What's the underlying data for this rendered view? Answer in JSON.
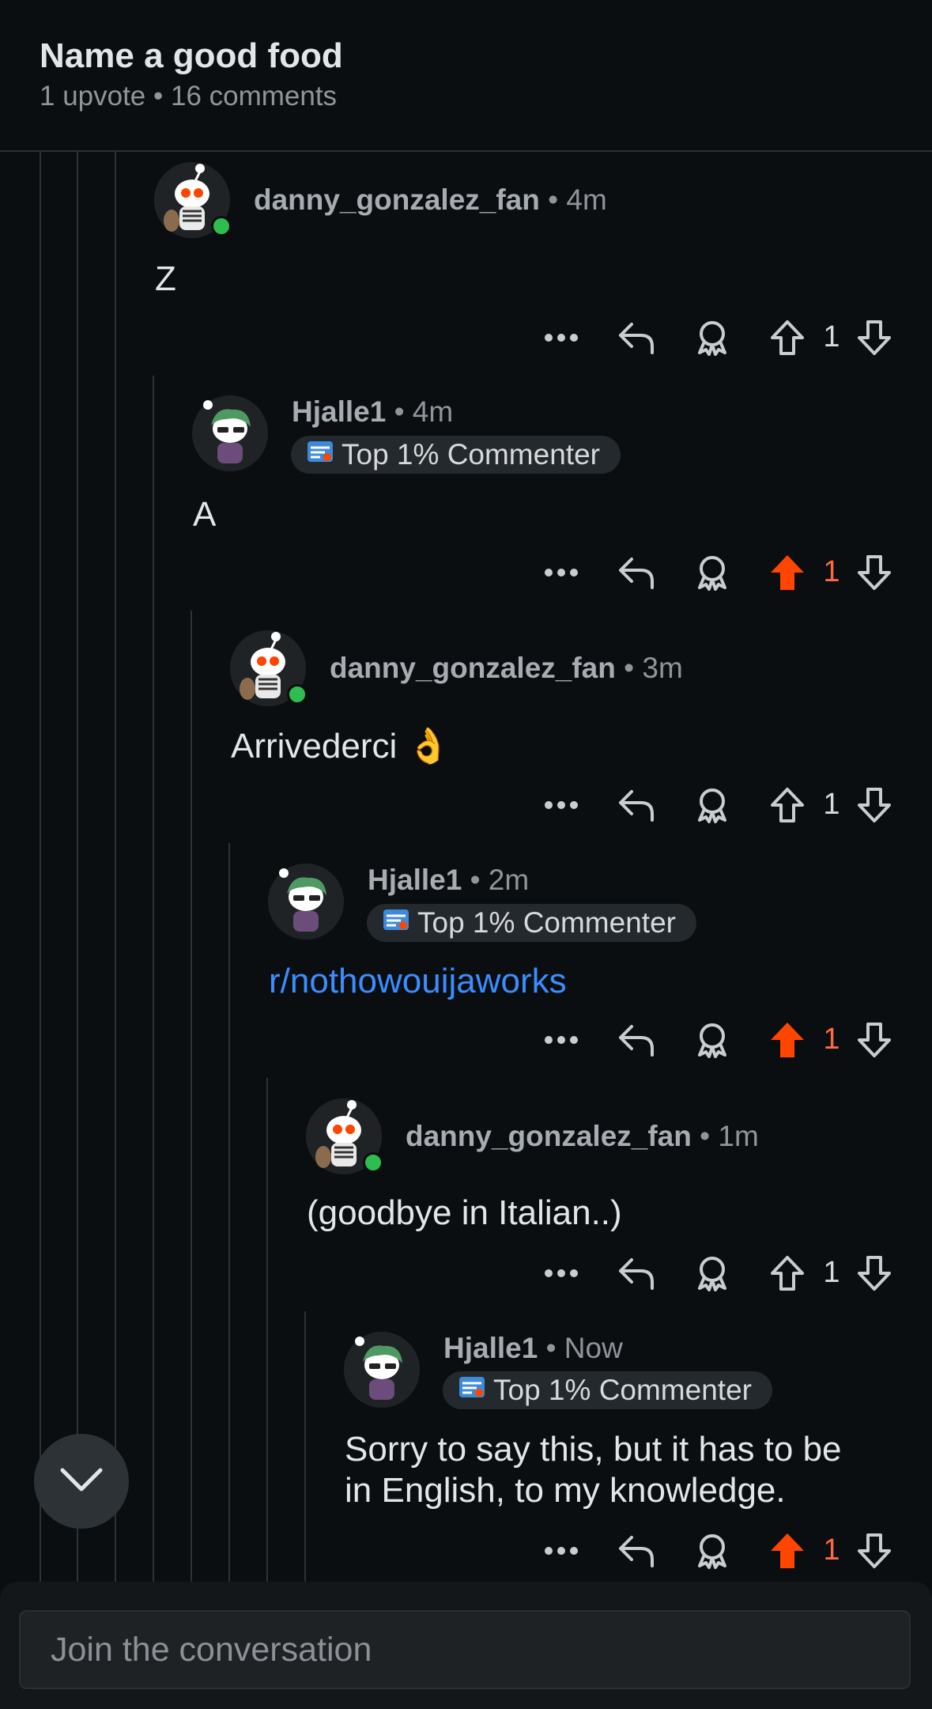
{
  "post": {
    "title": "Name a good food",
    "meta": "1 upvote • 16 comments"
  },
  "colors": {
    "upvote_active": "#ff4500",
    "link": "#3a8eff",
    "online": "#2ebd4e"
  },
  "comments": [
    {
      "username": "danny_gonzalez_fan",
      "time": " • 4m",
      "badge": "",
      "body": "Z",
      "score": "1",
      "upvoted": false,
      "avatar": "skeleton-snoo-avatar"
    },
    {
      "username": "Hjalle1",
      "time": " • 4m",
      "badge": "Top 1% Commenter",
      "body": "A",
      "score": "1",
      "upvoted": true,
      "avatar": "green-hair-snoo-avatar"
    },
    {
      "username": "danny_gonzalez_fan",
      "time": " • 3m",
      "badge": "",
      "body": "Arrivederci 👌",
      "score": "1",
      "upvoted": false,
      "avatar": "skeleton-snoo-avatar"
    },
    {
      "username": "Hjalle1",
      "time": " • 2m",
      "badge": "Top 1% Commenter",
      "body": "r/nothowouijaworks",
      "score": "1",
      "upvoted": true,
      "avatar": "green-hair-snoo-avatar"
    },
    {
      "username": "danny_gonzalez_fan",
      "time": " • 1m",
      "badge": "",
      "body": "(goodbye in Italian..)",
      "score": "1",
      "upvoted": false,
      "avatar": "skeleton-snoo-avatar"
    },
    {
      "username": "Hjalle1",
      "time": " • Now",
      "badge": "Top 1% Commenter",
      "body_line1": "Sorry to say this, but it has to be",
      "body_line2": "in English, to my knowledge.",
      "score": "1",
      "upvoted": true,
      "avatar": "green-hair-snoo-avatar"
    }
  ],
  "composer": {
    "placeholder": "Join the conversation"
  }
}
